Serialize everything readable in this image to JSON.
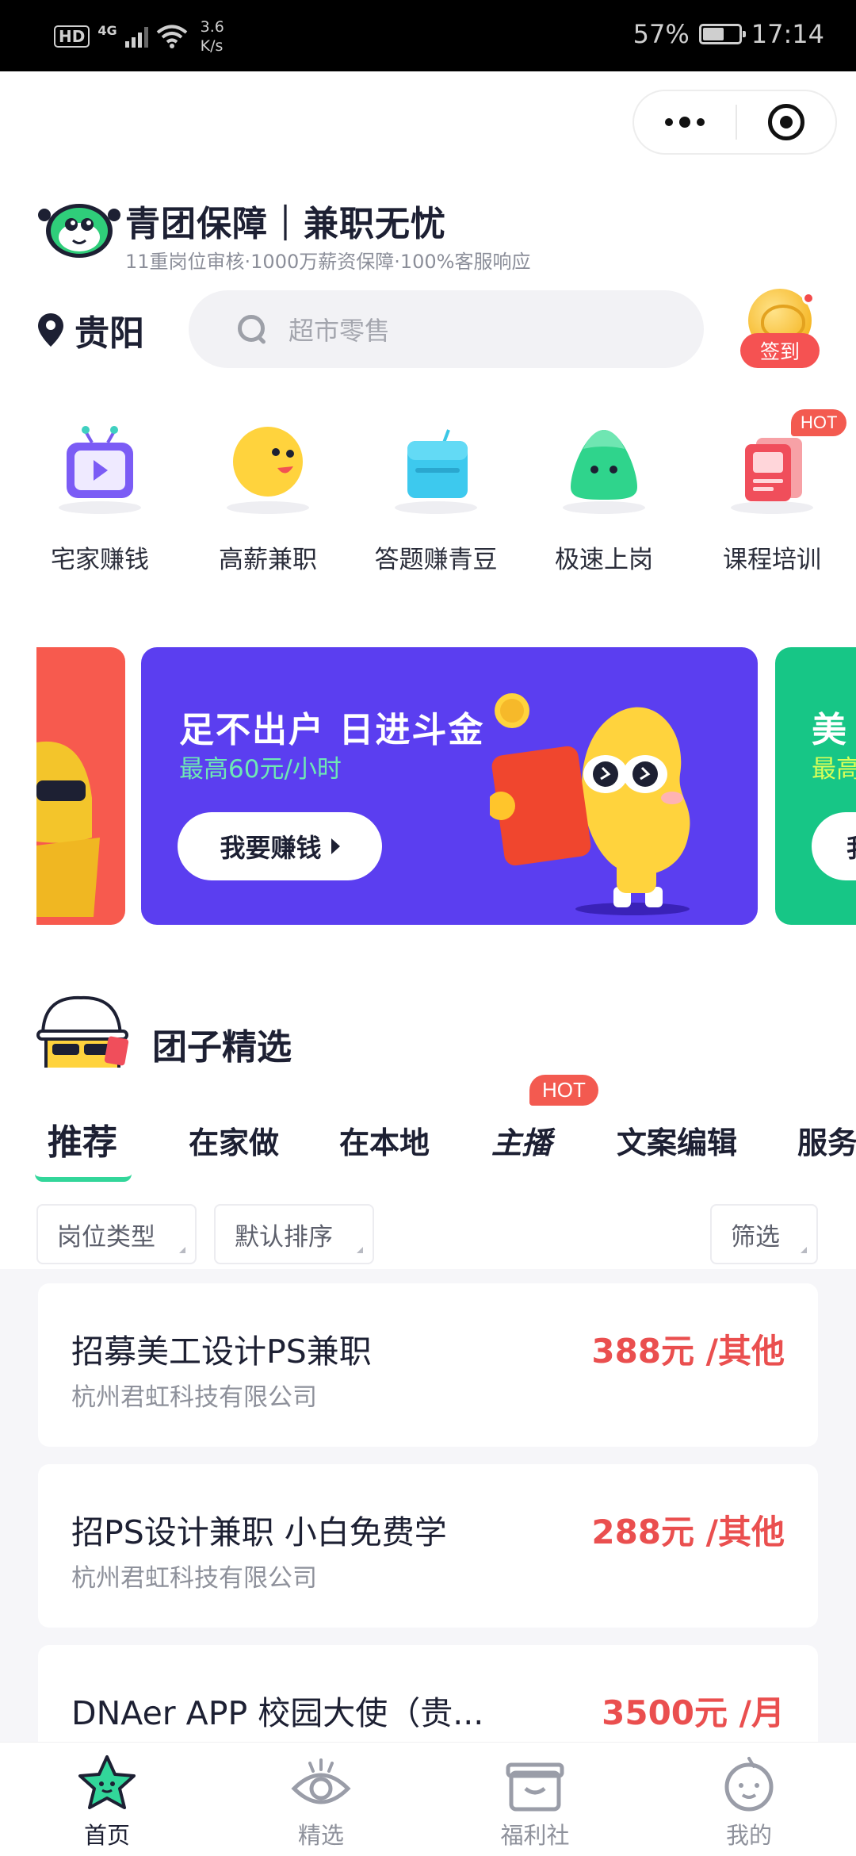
{
  "status_bar": {
    "hd": "HD",
    "network": "4G",
    "speed_value": "3.6",
    "speed_unit": "K/s",
    "battery": "57%",
    "time": "17:14"
  },
  "header": {
    "title": "青团保障｜兼职无忧",
    "subtitle": "11重岗位审核·1000万薪资保障·100%客服响应"
  },
  "location": {
    "city": "贵阳"
  },
  "search": {
    "placeholder": "超市零售"
  },
  "signin": {
    "label": "签到"
  },
  "categories": [
    {
      "label": "宅家赚钱",
      "icon": "tv-icon"
    },
    {
      "label": "高薪兼职",
      "icon": "smiley-icon"
    },
    {
      "label": "答题赚青豆",
      "icon": "box-icon"
    },
    {
      "label": "极速上岗",
      "icon": "blob-icon"
    },
    {
      "label": "课程培训",
      "icon": "book-icon",
      "badge": "HOT"
    }
  ],
  "banner": {
    "title": "足不出户 日进斗金",
    "subtitle": "最高60元/小时",
    "button": "我要赚钱",
    "colors": {
      "main": "#5b3ef0",
      "left": "#f75a4e",
      "right": "#17c686"
    }
  },
  "banner_right": {
    "title": "美",
    "subtitle": "最高",
    "button": "我"
  },
  "section": {
    "title": "团子精选"
  },
  "tabs": [
    {
      "label": "推荐",
      "active": true
    },
    {
      "label": "在家做"
    },
    {
      "label": "在本地"
    },
    {
      "label": "主播",
      "badge": "HOT"
    },
    {
      "label": "文案编辑"
    },
    {
      "label": "服务"
    }
  ],
  "filters": {
    "type": "岗位类型",
    "sort": "默认排序",
    "screen": "筛选"
  },
  "jobs": [
    {
      "title": "招募美工设计PS兼职",
      "company": "杭州君虹科技有限公司",
      "pay": "388元 /其他"
    },
    {
      "title": "招PS设计兼职 小白免费学",
      "company": "杭州君虹科技有限公司",
      "pay": "288元 /其他"
    },
    {
      "title": "DNAer APP 校园大使（贵...",
      "company": "",
      "pay": "3500元 /月"
    }
  ],
  "bottom_nav": [
    {
      "label": "首页",
      "active": true
    },
    {
      "label": "精选"
    },
    {
      "label": "福利社"
    },
    {
      "label": "我的"
    }
  ],
  "colors": {
    "accent_green": "#32d69a",
    "price_red": "#ea4f4f",
    "hot_red": "#f35a50"
  }
}
